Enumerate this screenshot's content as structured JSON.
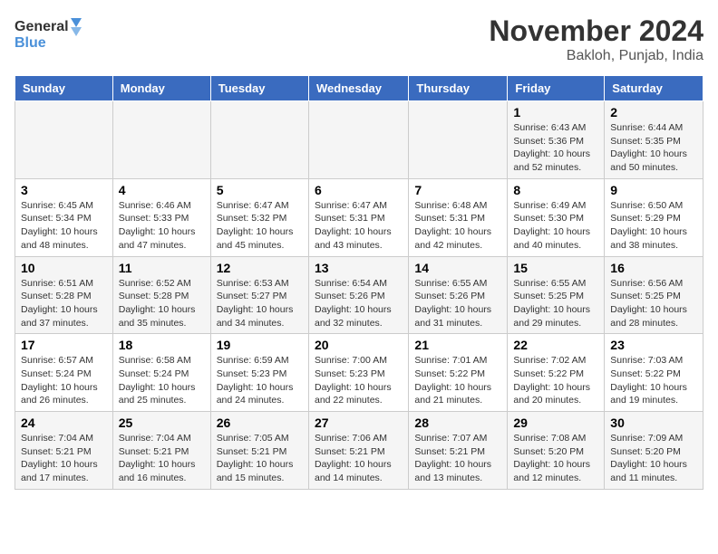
{
  "header": {
    "logo_line1": "General",
    "logo_line2": "Blue",
    "month_year": "November 2024",
    "location": "Bakloh, Punjab, India"
  },
  "days_of_week": [
    "Sunday",
    "Monday",
    "Tuesday",
    "Wednesday",
    "Thursday",
    "Friday",
    "Saturday"
  ],
  "weeks": [
    [
      {
        "num": "",
        "info": ""
      },
      {
        "num": "",
        "info": ""
      },
      {
        "num": "",
        "info": ""
      },
      {
        "num": "",
        "info": ""
      },
      {
        "num": "",
        "info": ""
      },
      {
        "num": "1",
        "info": "Sunrise: 6:43 AM\nSunset: 5:36 PM\nDaylight: 10 hours and 52 minutes."
      },
      {
        "num": "2",
        "info": "Sunrise: 6:44 AM\nSunset: 5:35 PM\nDaylight: 10 hours and 50 minutes."
      }
    ],
    [
      {
        "num": "3",
        "info": "Sunrise: 6:45 AM\nSunset: 5:34 PM\nDaylight: 10 hours and 48 minutes."
      },
      {
        "num": "4",
        "info": "Sunrise: 6:46 AM\nSunset: 5:33 PM\nDaylight: 10 hours and 47 minutes."
      },
      {
        "num": "5",
        "info": "Sunrise: 6:47 AM\nSunset: 5:32 PM\nDaylight: 10 hours and 45 minutes."
      },
      {
        "num": "6",
        "info": "Sunrise: 6:47 AM\nSunset: 5:31 PM\nDaylight: 10 hours and 43 minutes."
      },
      {
        "num": "7",
        "info": "Sunrise: 6:48 AM\nSunset: 5:31 PM\nDaylight: 10 hours and 42 minutes."
      },
      {
        "num": "8",
        "info": "Sunrise: 6:49 AM\nSunset: 5:30 PM\nDaylight: 10 hours and 40 minutes."
      },
      {
        "num": "9",
        "info": "Sunrise: 6:50 AM\nSunset: 5:29 PM\nDaylight: 10 hours and 38 minutes."
      }
    ],
    [
      {
        "num": "10",
        "info": "Sunrise: 6:51 AM\nSunset: 5:28 PM\nDaylight: 10 hours and 37 minutes."
      },
      {
        "num": "11",
        "info": "Sunrise: 6:52 AM\nSunset: 5:28 PM\nDaylight: 10 hours and 35 minutes."
      },
      {
        "num": "12",
        "info": "Sunrise: 6:53 AM\nSunset: 5:27 PM\nDaylight: 10 hours and 34 minutes."
      },
      {
        "num": "13",
        "info": "Sunrise: 6:54 AM\nSunset: 5:26 PM\nDaylight: 10 hours and 32 minutes."
      },
      {
        "num": "14",
        "info": "Sunrise: 6:55 AM\nSunset: 5:26 PM\nDaylight: 10 hours and 31 minutes."
      },
      {
        "num": "15",
        "info": "Sunrise: 6:55 AM\nSunset: 5:25 PM\nDaylight: 10 hours and 29 minutes."
      },
      {
        "num": "16",
        "info": "Sunrise: 6:56 AM\nSunset: 5:25 PM\nDaylight: 10 hours and 28 minutes."
      }
    ],
    [
      {
        "num": "17",
        "info": "Sunrise: 6:57 AM\nSunset: 5:24 PM\nDaylight: 10 hours and 26 minutes."
      },
      {
        "num": "18",
        "info": "Sunrise: 6:58 AM\nSunset: 5:24 PM\nDaylight: 10 hours and 25 minutes."
      },
      {
        "num": "19",
        "info": "Sunrise: 6:59 AM\nSunset: 5:23 PM\nDaylight: 10 hours and 24 minutes."
      },
      {
        "num": "20",
        "info": "Sunrise: 7:00 AM\nSunset: 5:23 PM\nDaylight: 10 hours and 22 minutes."
      },
      {
        "num": "21",
        "info": "Sunrise: 7:01 AM\nSunset: 5:22 PM\nDaylight: 10 hours and 21 minutes."
      },
      {
        "num": "22",
        "info": "Sunrise: 7:02 AM\nSunset: 5:22 PM\nDaylight: 10 hours and 20 minutes."
      },
      {
        "num": "23",
        "info": "Sunrise: 7:03 AM\nSunset: 5:22 PM\nDaylight: 10 hours and 19 minutes."
      }
    ],
    [
      {
        "num": "24",
        "info": "Sunrise: 7:04 AM\nSunset: 5:21 PM\nDaylight: 10 hours and 17 minutes."
      },
      {
        "num": "25",
        "info": "Sunrise: 7:04 AM\nSunset: 5:21 PM\nDaylight: 10 hours and 16 minutes."
      },
      {
        "num": "26",
        "info": "Sunrise: 7:05 AM\nSunset: 5:21 PM\nDaylight: 10 hours and 15 minutes."
      },
      {
        "num": "27",
        "info": "Sunrise: 7:06 AM\nSunset: 5:21 PM\nDaylight: 10 hours and 14 minutes."
      },
      {
        "num": "28",
        "info": "Sunrise: 7:07 AM\nSunset: 5:21 PM\nDaylight: 10 hours and 13 minutes."
      },
      {
        "num": "29",
        "info": "Sunrise: 7:08 AM\nSunset: 5:20 PM\nDaylight: 10 hours and 12 minutes."
      },
      {
        "num": "30",
        "info": "Sunrise: 7:09 AM\nSunset: 5:20 PM\nDaylight: 10 hours and 11 minutes."
      }
    ]
  ]
}
